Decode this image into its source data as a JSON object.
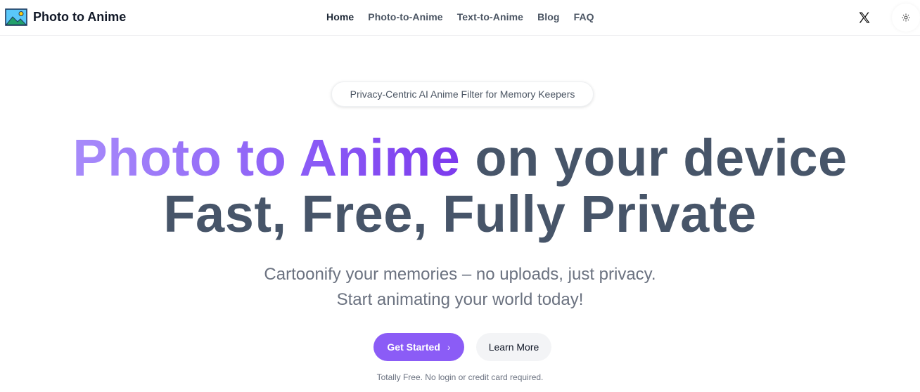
{
  "header": {
    "brand_name": "Photo to Anime",
    "logo_icon": "landscape-image-icon",
    "nav": [
      {
        "label": "Home",
        "active": true
      },
      {
        "label": "Photo-to-Anime",
        "active": false
      },
      {
        "label": "Text-to-Anime",
        "active": false
      },
      {
        "label": "Blog",
        "active": false
      },
      {
        "label": "FAQ",
        "active": false
      }
    ],
    "social_icon": "x-twitter-icon",
    "theme_icon": "sun-icon"
  },
  "hero": {
    "badge": "Privacy-Centric AI Anime Filter for Memory Keepers",
    "headline_highlight": "Photo to Anime",
    "headline_rest": " on your device",
    "headline_line2": "Fast, Free, Fully Private",
    "subtitle_line1": "Cartoonify your memories – no uploads, just privacy.",
    "subtitle_line2": "Start animating your world today!",
    "primary_button": "Get Started",
    "primary_chevron": "›",
    "secondary_button": "Learn More",
    "note": "Totally Free. No login or credit card required."
  },
  "colors": {
    "accent": "#8b5cf6",
    "heading": "#475569"
  }
}
